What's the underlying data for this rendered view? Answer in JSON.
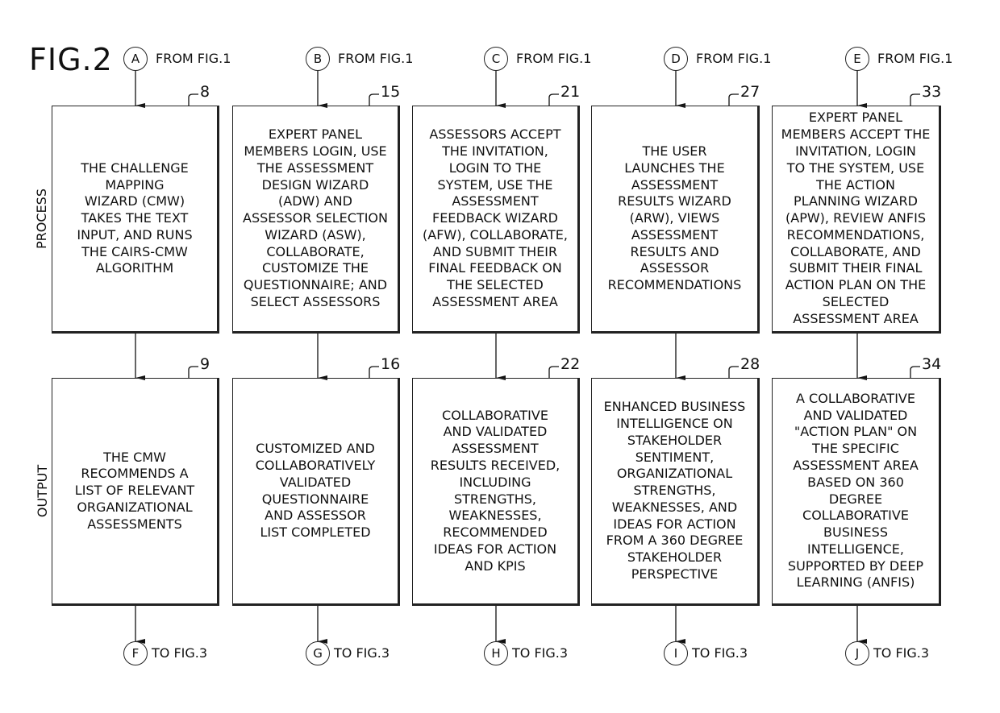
{
  "figure": {
    "title": "FIG.2"
  },
  "row_labels": {
    "process": "PROCESS",
    "output": "OUTPUT"
  },
  "inputs": [
    {
      "letter": "A",
      "label": "FROM FIG.1"
    },
    {
      "letter": "B",
      "label": "FROM FIG.1"
    },
    {
      "letter": "C",
      "label": "FROM FIG.1"
    },
    {
      "letter": "D",
      "label": "FROM FIG.1"
    },
    {
      "letter": "E",
      "label": "FROM FIG.1"
    }
  ],
  "process_boxes": [
    {
      "ref": "8",
      "text": "THE CHALLENGE\nMAPPING\nWIZARD (CMW)\nTAKES THE TEXT\nINPUT, AND RUNS\nTHE CAIRS-CMW\nALGORITHM"
    },
    {
      "ref": "15",
      "text": "EXPERT PANEL\nMEMBERS LOGIN, USE\nTHE ASSESSMENT\nDESIGN WIZARD\n(ADW) AND\nASSESSOR SELECTION\nWIZARD (ASW),\nCOLLABORATE,\nCUSTOMIZE THE\nQUESTIONNAIRE; AND\nSELECT ASSESSORS"
    },
    {
      "ref": "21",
      "text": "ASSESSORS ACCEPT\nTHE INVITATION,\nLOGIN TO THE\nSYSTEM, USE THE\nASSESSMENT\nFEEDBACK WIZARD\n(AFW), COLLABORATE,\nAND SUBMIT THEIR\nFINAL FEEDBACK ON\nTHE SELECTED\nASSESSMENT AREA"
    },
    {
      "ref": "27",
      "text": "THE USER\nLAUNCHES THE\nASSESSMENT\nRESULTS WIZARD\n(ARW), VIEWS\nASSESSMENT\nRESULTS AND\nASSESSOR\nRECOMMENDATIONS"
    },
    {
      "ref": "33",
      "text": "EXPERT PANEL\nMEMBERS ACCEPT THE\nINVITATION, LOGIN\nTO THE SYSTEM, USE\nTHE ACTION\nPLANNING WIZARD\n(APW), REVIEW ANFIS\nRECOMMENDATIONS,\nCOLLABORATE, AND\nSUBMIT THEIR FINAL\nACTION PLAN ON THE\nSELECTED\nASSESSMENT AREA"
    }
  ],
  "output_boxes": [
    {
      "ref": "9",
      "text": "THE CMW\nRECOMMENDS A\nLIST OF RELEVANT\nORGANIZATIONAL\nASSESSMENTS"
    },
    {
      "ref": "16",
      "text": "CUSTOMIZED AND\nCOLLABORATIVELY\nVALIDATED\nQUESTIONNAIRE\nAND ASSESSOR\nLIST COMPLETED"
    },
    {
      "ref": "22",
      "text": "COLLABORATIVE\nAND VALIDATED\nASSESSMENT\nRESULTS RECEIVED,\nINCLUDING\nSTRENGTHS,\nWEAKNESSES,\nRECOMMENDED\nIDEAS FOR ACTION\nAND KPIS"
    },
    {
      "ref": "28",
      "text": "ENHANCED BUSINESS\nINTELLIGENCE ON\nSTAKEHOLDER\nSENTIMENT,\nORGANIZATIONAL\nSTRENGTHS,\nWEAKNESSES, AND\nIDEAS FOR ACTION\nFROM A 360 DEGREE\nSTAKEHOLDER\nPERSPECTIVE"
    },
    {
      "ref": "34",
      "text": "A COLLABORATIVE\nAND VALIDATED\n\"ACTION PLAN\" ON\nTHE SPECIFIC\nASSESSMENT AREA\nBASED ON 360\nDEGREE\nCOLLABORATIVE\nBUSINESS\nINTELLIGENCE,\nSUPPORTED BY DEEP\nLEARNING (ANFIS)"
    }
  ],
  "outputs": [
    {
      "letter": "F",
      "label": "TO FIG.3"
    },
    {
      "letter": "G",
      "label": "TO FIG.3"
    },
    {
      "letter": "H",
      "label": "TO FIG.3"
    },
    {
      "letter": "I",
      "label": "TO FIG.3"
    },
    {
      "letter": "J",
      "label": "TO FIG.3"
    }
  ]
}
